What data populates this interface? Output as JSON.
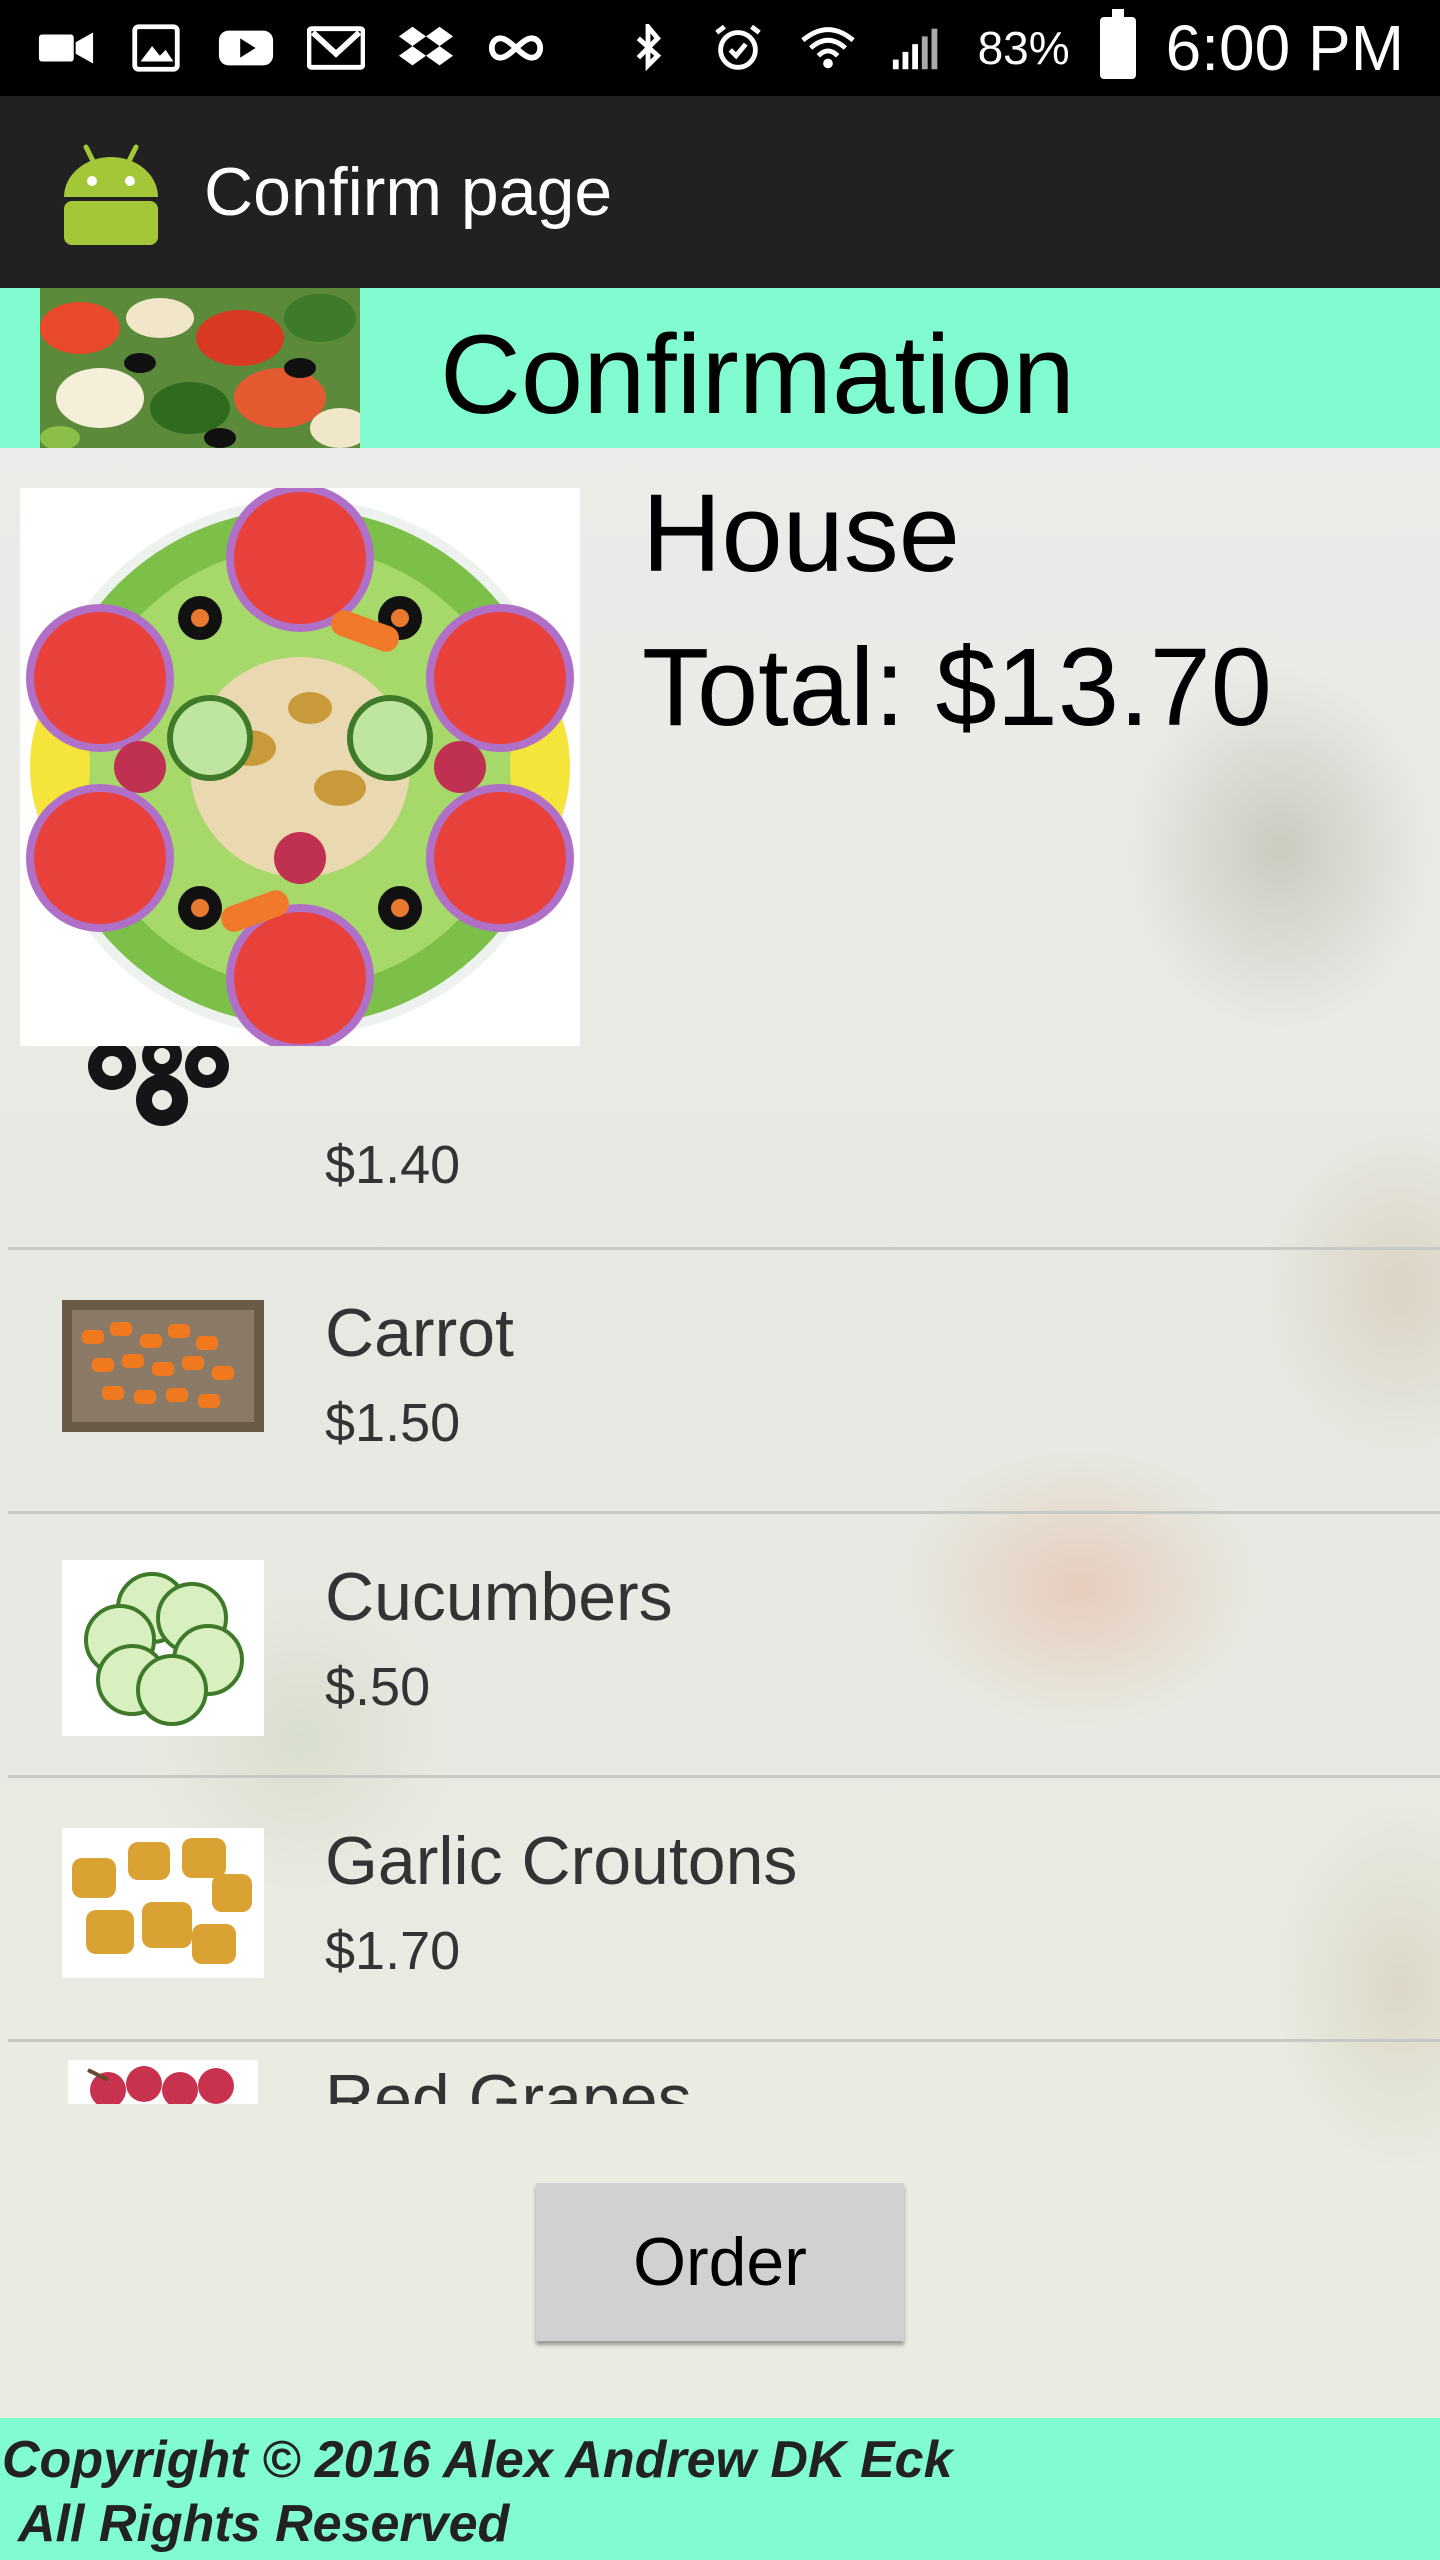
{
  "status_bar": {
    "battery_percent": "83%",
    "time": "6:00 PM",
    "icons": [
      "video-icon",
      "gallery-icon",
      "youtube-icon",
      "gmail-icon",
      "dropbox-icon",
      "infinity-icon",
      "bluetooth-icon",
      "alarm-icon",
      "wifi-icon",
      "signal-icon",
      "battery-icon"
    ]
  },
  "action_bar": {
    "title": "Confirm page"
  },
  "banner": {
    "title": "Confirmation"
  },
  "salad": {
    "name": "House",
    "total": "Total: $13.70"
  },
  "ingredients": [
    {
      "name": "",
      "price": "$1.40",
      "thumb": "black-olives"
    },
    {
      "name": "Carrot",
      "price": "$1.50",
      "thumb": "carrot"
    },
    {
      "name": "Cucumbers",
      "price": "$.50",
      "thumb": "cucumbers"
    },
    {
      "name": "Garlic Croutons",
      "price": "$1.70",
      "thumb": "croutons"
    },
    {
      "name": "Red Grapes",
      "price": "",
      "thumb": "red-grapes"
    }
  ],
  "order_button": {
    "label": "Order"
  },
  "footer": {
    "line1": "Copyright © 2016 Alex Andrew DK Eck",
    "line2": "All Rights Reserved"
  },
  "colors": {
    "accent": "#80fcd0",
    "status_bar": "#000000",
    "action_bar": "#212121",
    "button": "#d1d1d1"
  }
}
